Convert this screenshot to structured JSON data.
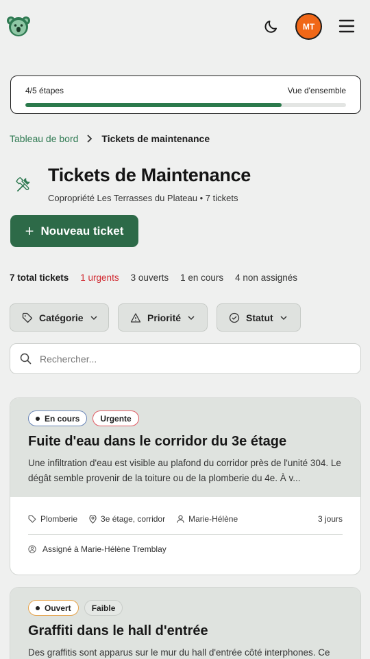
{
  "header": {
    "logo_icon": "koala-logo-icon",
    "theme_icon": "moon-icon",
    "avatar_initials": "MT",
    "menu_icon": "hamburger-menu-icon",
    "avatar_color": "#f06717"
  },
  "progress": {
    "steps_label": "4/5 étapes",
    "overview_label": "Vue d'ensemble",
    "fraction": 0.8
  },
  "breadcrumb": {
    "parent": "Tableau de bord",
    "current": "Tickets de maintenance"
  },
  "page": {
    "title": "Tickets de Maintenance",
    "subtitle": "Copropriété Les Terrasses du Plateau • 7 tickets",
    "new_button": "Nouveau ticket"
  },
  "stats": {
    "total": "7 total tickets",
    "urgent": "1 urgents",
    "open": "3 ouverts",
    "in_progress": "1 en cours",
    "unassigned": "4 non assignés"
  },
  "filters": {
    "category": "Catégorie",
    "priority": "Priorité",
    "status": "Statut"
  },
  "search": {
    "placeholder": "Rechercher..."
  },
  "tickets": [
    {
      "status": "En cours",
      "priority": "Urgente",
      "title": "Fuite d'eau dans le corridor du 3e étage",
      "description": "Une infiltration d'eau est visible au plafond du corridor près de l'unité 304. Le dégât semble provenir de la toiture ou de la plomberie du 4e. À v...",
      "category": "Plomberie",
      "location": "3e étage, corridor",
      "reporter": "Marie-Hélène",
      "age": "3 jours",
      "assigned": "Assigné à Marie-Hélène Tremblay"
    },
    {
      "status": "Ouvert",
      "priority": "Faible",
      "title": "Graffiti dans le hall d'entrée",
      "description": "Des graffitis sont apparus sur le mur du hall d'entrée côté interphones. Ce"
    }
  ],
  "colors": {
    "primary_green": "#2d6a48",
    "urgent_red": "#d0282f",
    "background": "#eff0ef"
  }
}
